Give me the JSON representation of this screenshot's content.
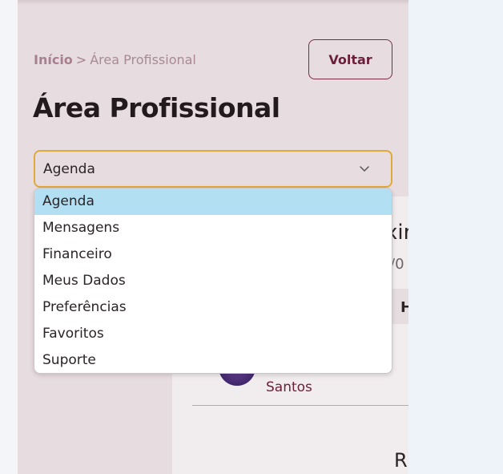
{
  "breadcrumb": {
    "home": "Início",
    "separator": ">",
    "current": "Área Profissional"
  },
  "back_button": "Voltar",
  "page_title": "Área Profissional",
  "select": {
    "value": "Agenda",
    "options": [
      "Agenda",
      "Mensagens",
      "Financeiro",
      "Meus Dados",
      "Preferências",
      "Favoritos",
      "Suporte"
    ],
    "selected_index": 0
  },
  "background_content": {
    "fragment_1": "xir",
    "fragment_2": "/0",
    "fragment_3": "H",
    "name": "Santos",
    "fragment_4": "R"
  },
  "colors": {
    "accent": "#6b1f3a",
    "focus_border": "#e0a93a",
    "selected_option": "#b2dff2"
  }
}
